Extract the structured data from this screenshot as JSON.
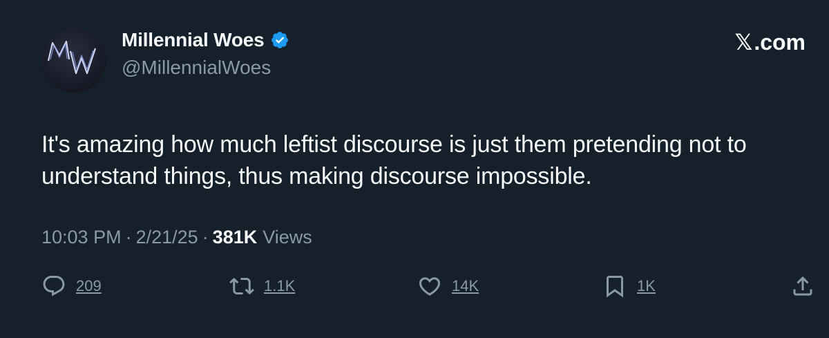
{
  "author": {
    "display_name": "Millennial Woes",
    "handle": "@MillennialWoes",
    "verified": true,
    "avatar_text": "MW"
  },
  "brand": {
    "label": "X.com",
    "x_glyph": "𝕏",
    "suffix": ".com"
  },
  "tweet": {
    "text": "It's amazing how much leftist discourse is just them pretending not to understand things, thus making discourse impossible."
  },
  "meta": {
    "time": "10:03 PM",
    "date": "2/21/25",
    "views_count": "381K",
    "views_label": "Views",
    "separator": "·"
  },
  "actions": {
    "reply": {
      "icon": "reply-icon",
      "count": "209"
    },
    "retweet": {
      "icon": "retweet-icon",
      "count": "1.1K"
    },
    "like": {
      "icon": "heart-icon",
      "count": "14K"
    },
    "bookmark": {
      "icon": "bookmark-icon",
      "count": "1K"
    },
    "share": {
      "icon": "share-icon"
    }
  },
  "colors": {
    "background": "#15202b",
    "text_primary": "#f7f9f9",
    "text_secondary": "#8b98a5",
    "verified_blue": "#1d9bf0"
  }
}
